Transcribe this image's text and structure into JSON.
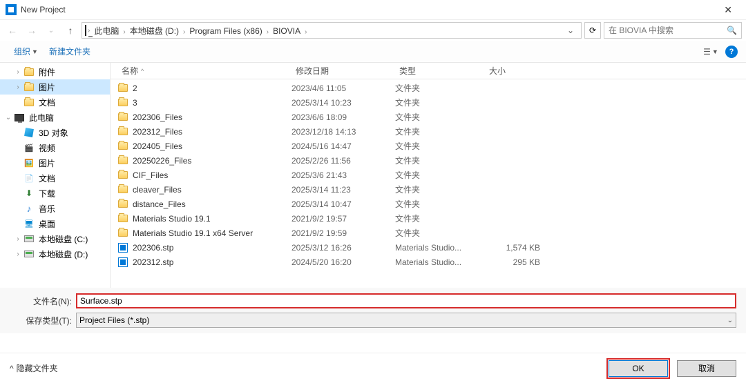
{
  "window": {
    "title": "New Project"
  },
  "breadcrumb": {
    "items": [
      "此电脑",
      "本地磁盘 (D:)",
      "Program Files (x86)",
      "BIOVIA"
    ],
    "search_placeholder": "在 BIOVIA 中搜索"
  },
  "toolbar": {
    "organize": "组织",
    "newfolder": "新建文件夹"
  },
  "sidebar": {
    "items": [
      {
        "label": "附件",
        "icon": "folder",
        "indent": 1,
        "exp": "›"
      },
      {
        "label": "图片",
        "icon": "folder",
        "indent": 1,
        "exp": "›",
        "selected": true
      },
      {
        "label": "文档",
        "icon": "folder",
        "indent": 1,
        "exp": ""
      },
      {
        "label": "此电脑",
        "icon": "pc",
        "indent": 0,
        "exp": "⌄"
      },
      {
        "label": "3D 对象",
        "icon": "cube",
        "indent": 1,
        "exp": ""
      },
      {
        "label": "视频",
        "icon": "clip",
        "indent": 1,
        "exp": ""
      },
      {
        "label": "图片",
        "icon": "img",
        "indent": 1,
        "exp": ""
      },
      {
        "label": "文档",
        "icon": "doc",
        "indent": 1,
        "exp": ""
      },
      {
        "label": "下载",
        "icon": "down",
        "indent": 1,
        "exp": ""
      },
      {
        "label": "音乐",
        "icon": "music",
        "indent": 1,
        "exp": ""
      },
      {
        "label": "桌面",
        "icon": "desk",
        "indent": 1,
        "exp": ""
      },
      {
        "label": "本地磁盘 (C:)",
        "icon": "drive",
        "indent": 1,
        "exp": "›"
      },
      {
        "label": "本地磁盘 (D:)",
        "icon": "drive",
        "indent": 1,
        "exp": "›"
      }
    ]
  },
  "columns": {
    "name": "名称",
    "date": "修改日期",
    "type": "类型",
    "size": "大小"
  },
  "files": [
    {
      "name": "2",
      "date": "2023/4/6 11:05",
      "type": "文件夹",
      "size": "",
      "icon": "folder"
    },
    {
      "name": "3",
      "date": "2025/3/14 10:23",
      "type": "文件夹",
      "size": "",
      "icon": "folder"
    },
    {
      "name": "202306_Files",
      "date": "2023/6/6 18:09",
      "type": "文件夹",
      "size": "",
      "icon": "folder"
    },
    {
      "name": "202312_Files",
      "date": "2023/12/18 14:13",
      "type": "文件夹",
      "size": "",
      "icon": "folder"
    },
    {
      "name": "202405_Files",
      "date": "2024/5/16 14:47",
      "type": "文件夹",
      "size": "",
      "icon": "folder"
    },
    {
      "name": "20250226_Files",
      "date": "2025/2/26 11:56",
      "type": "文件夹",
      "size": "",
      "icon": "folder"
    },
    {
      "name": "CIF_Files",
      "date": "2025/3/6 21:43",
      "type": "文件夹",
      "size": "",
      "icon": "folder"
    },
    {
      "name": "cleaver_Files",
      "date": "2025/3/14 11:23",
      "type": "文件夹",
      "size": "",
      "icon": "folder"
    },
    {
      "name": "distance_Files",
      "date": "2025/3/14 10:47",
      "type": "文件夹",
      "size": "",
      "icon": "folder"
    },
    {
      "name": "Materials Studio 19.1",
      "date": "2021/9/2 19:57",
      "type": "文件夹",
      "size": "",
      "icon": "folder"
    },
    {
      "name": "Materials Studio 19.1 x64 Server",
      "date": "2021/9/2 19:59",
      "type": "文件夹",
      "size": "",
      "icon": "folder"
    },
    {
      "name": "202306.stp",
      "date": "2025/3/12 16:26",
      "type": "Materials Studio...",
      "size": "1,574 KB",
      "icon": "stp"
    },
    {
      "name": "202312.stp",
      "date": "2024/5/20 16:20",
      "type": "Materials Studio...",
      "size": "295 KB",
      "icon": "stp"
    }
  ],
  "fields": {
    "filename_label": "文件名(N):",
    "filename_value": "Surface.stp",
    "savetype_label": "保存类型(T):",
    "savetype_value": "Project Files (*.stp)"
  },
  "footer": {
    "hide": "隐藏文件夹",
    "ok": "OK",
    "cancel": "取消"
  }
}
